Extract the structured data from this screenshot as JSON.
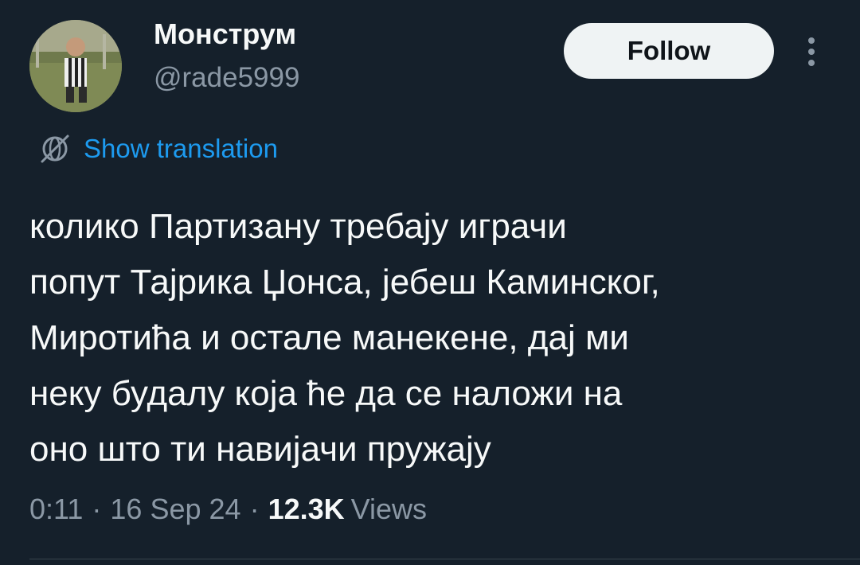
{
  "author": {
    "display_name": "Монструм",
    "handle": "@rade5999"
  },
  "actions": {
    "follow_label": "Follow",
    "more_icon": "more-vertical-icon"
  },
  "translation": {
    "icon": "globe-icon",
    "label": "Show translation"
  },
  "tweet": {
    "lines": [
      "колико Партизану требају играчи",
      "попут Тајрика Џонса, јебеш Каминског,",
      "Миротића и остале манекене, дај ми",
      "неку будалу која ће да се наложи на",
      "оно што ти навијачи пружају"
    ]
  },
  "meta": {
    "time": "0:11",
    "separator": "·",
    "date": "16 Sep 24",
    "views_count": "12.3K",
    "views_label": "Views"
  },
  "colors": {
    "background": "#15202b",
    "text": "#f7f9f9",
    "secondary": "#8b98a5",
    "link": "#1d9bf0",
    "button_bg": "#eff3f4"
  }
}
